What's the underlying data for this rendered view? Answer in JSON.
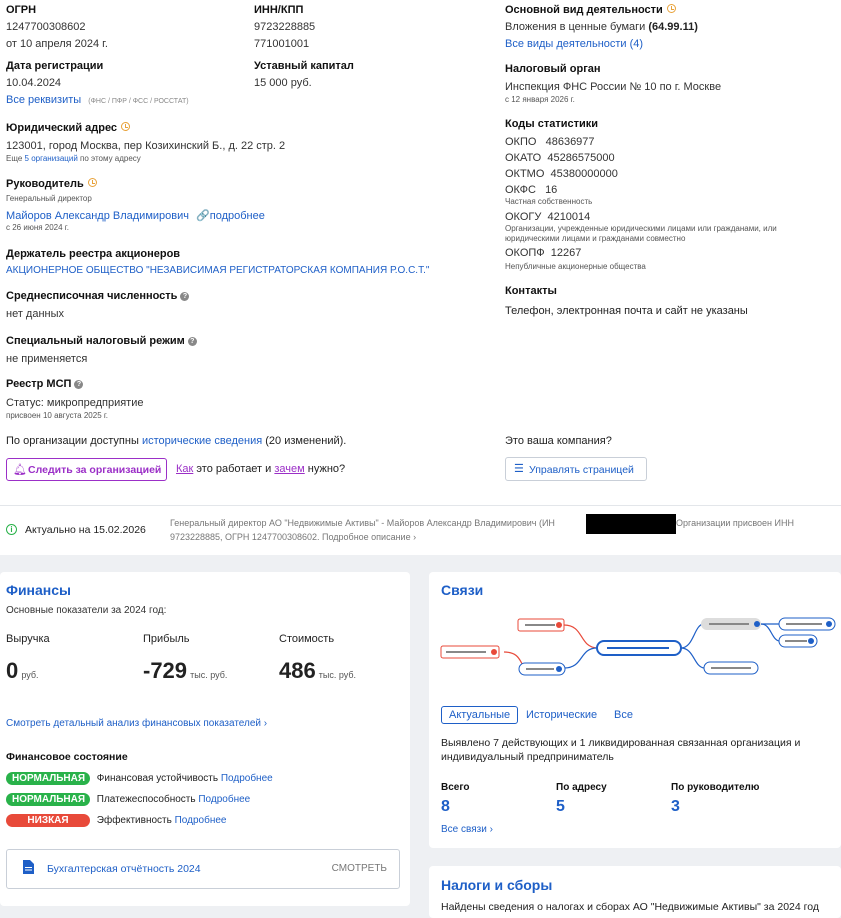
{
  "left": {
    "ogrn_label": "ОГРН",
    "ogrn_value": "1247700308602",
    "ogrn_date": "от 10 апреля 2024 г.",
    "reg_date_label": "Дата регистрации",
    "reg_date_value": "10.04.2024",
    "all_details_link": "Все реквизиты",
    "all_details_note": "(ФНС / ПФР / ФСС / РОССТАТ)",
    "address_label": "Юридический адрес",
    "address_value": "123001, город Москва, пер Козихинский Б., д. 22 стр. 2",
    "address_note_prefix": "Еще",
    "address_note_link": "5 организаций",
    "address_note_suffix": "по этому адресу",
    "head_label": "Руководитель",
    "head_role": "Генеральный директор",
    "head_name": "Майоров Александр Владимирович",
    "head_more": "подробнее",
    "head_since": "с 26 июня 2024 г.",
    "registry_holder_label": "Держатель реестра акционеров",
    "registry_holder_value": "АКЦИОНЕРНОЕ ОБЩЕСТВО \"НЕЗАВИСИМАЯ РЕГИСТРАТОРСКАЯ КОМПАНИЯ Р.О.С.Т.\"",
    "headcount_label": "Среднесписочная численность",
    "headcount_value": "нет данных",
    "tax_regime_label": "Специальный налоговый режим",
    "tax_regime_value": "не применяется",
    "msp_label": "Реестр МСП",
    "msp_status": "Статус: микропредприятие",
    "msp_assigned": "присвоен 10 августа 2025 г.",
    "history_prefix": "По организации доступны",
    "history_link": "исторические сведения",
    "history_suffix": "(20 изменений).",
    "follow_button": "Следить за организацией",
    "how_link": "Как",
    "how_mid": "это работает и",
    "why_link": "зачем",
    "why_suffix": "нужно?"
  },
  "middle": {
    "inn_label": "ИНН/КПП",
    "inn_value": "9723228885",
    "kpp_value": "771001001",
    "capital_label": "Уставный капитал",
    "capital_value": "15 000 руб."
  },
  "right": {
    "activity_label": "Основной вид деятельности",
    "activity_value": "Вложения в ценные бумаги",
    "activity_code": "(64.99.11)",
    "all_activities_link": "Все виды деятельности (4)",
    "tax_authority_label": "Налоговый орган",
    "tax_authority_value": "Инспекция ФНС России № 10 по г. Москве",
    "tax_authority_since": "с 12 января 2026 г.",
    "stats_label": "Коды статистики",
    "okpo": "ОКПО   48636977",
    "okato": "ОКАТО  45286575000",
    "oktmo": "ОКТМО  45380000000",
    "okfs": "ОКФС   16",
    "okfs_desc": "Частная собственность",
    "okogu": "ОКОГУ  4210014",
    "okogu_desc1": "Организации, учрежденные юридическими лицами или гражданами, или",
    "okogu_desc2": "юридическими лицами и гражданами совместно",
    "okopf": "ОКОПФ  12267",
    "okopf_desc": "Непубличные акционерные общества",
    "contacts_label": "Контакты",
    "contacts_value": "Телефон, электронная почта и сайт не указаны",
    "your_company": "Это ваша компания?",
    "manage_button": "Управлять страницей"
  },
  "actual": {
    "label": "Актуально на 15.02.2026",
    "text1_a": "Генеральный директор АО \"Недвижимые Активы\" - Майоров Александр Владимирович (ИН",
    "text1_b": "Организации присвоен ИНН",
    "text2": "9723228885, ОГРН 1247700308602. Подробное описание ›"
  },
  "finance": {
    "title": "Финансы",
    "subtitle": "Основные показатели за 2024 год:",
    "revenue_label": "Выручка",
    "revenue_value": "0",
    "revenue_unit": "руб.",
    "profit_label": "Прибыль",
    "profit_value": "-729",
    "profit_unit": "тыс. руб.",
    "cost_label": "Стоимость",
    "cost_value": "486",
    "cost_unit": "тыс. руб.",
    "analysis_link": "Смотреть детальный анализ финансовых показателей ›",
    "state_label": "Финансовое состояние",
    "rows": [
      {
        "badge": "НОРМАЛЬНАЯ",
        "text": "Финансовая устойчивость",
        "link": "Подробнее"
      },
      {
        "badge": "НОРМАЛЬНАЯ",
        "text": "Платежеспособность",
        "link": "Подробнее"
      },
      {
        "badge": "НИЗКАЯ",
        "text": "Эффективность",
        "link": "Подробнее"
      }
    ],
    "report_label": "Бухгалтерская отчётность 2024",
    "report_action": "СМОТРЕТЬ"
  },
  "links": {
    "title": "Связи",
    "tab_actual": "Актуальные",
    "tab_history": "Исторические",
    "tab_all": "Все",
    "desc1": "Выявлено 7 действующих и 1 ликвидированная связанная организация и",
    "desc2": "индивидуальный предприниматель",
    "total_label": "Всего",
    "total_value": "8",
    "address_label": "По адресу",
    "address_value": "5",
    "head_label": "По руководителю",
    "head_value": "3",
    "all_link": "Все связи ›"
  },
  "taxes": {
    "title": "Налоги и сборы",
    "text": "Найдены сведения о налогах и сборах АО \"Недвижимые Активы\" за 2024 год"
  },
  "colors": {
    "accent": "#1e5fc7",
    "green": "#29b24a",
    "red": "#e84a3a",
    "purple": "#9b2fc7",
    "orange": "#e8a23a"
  }
}
